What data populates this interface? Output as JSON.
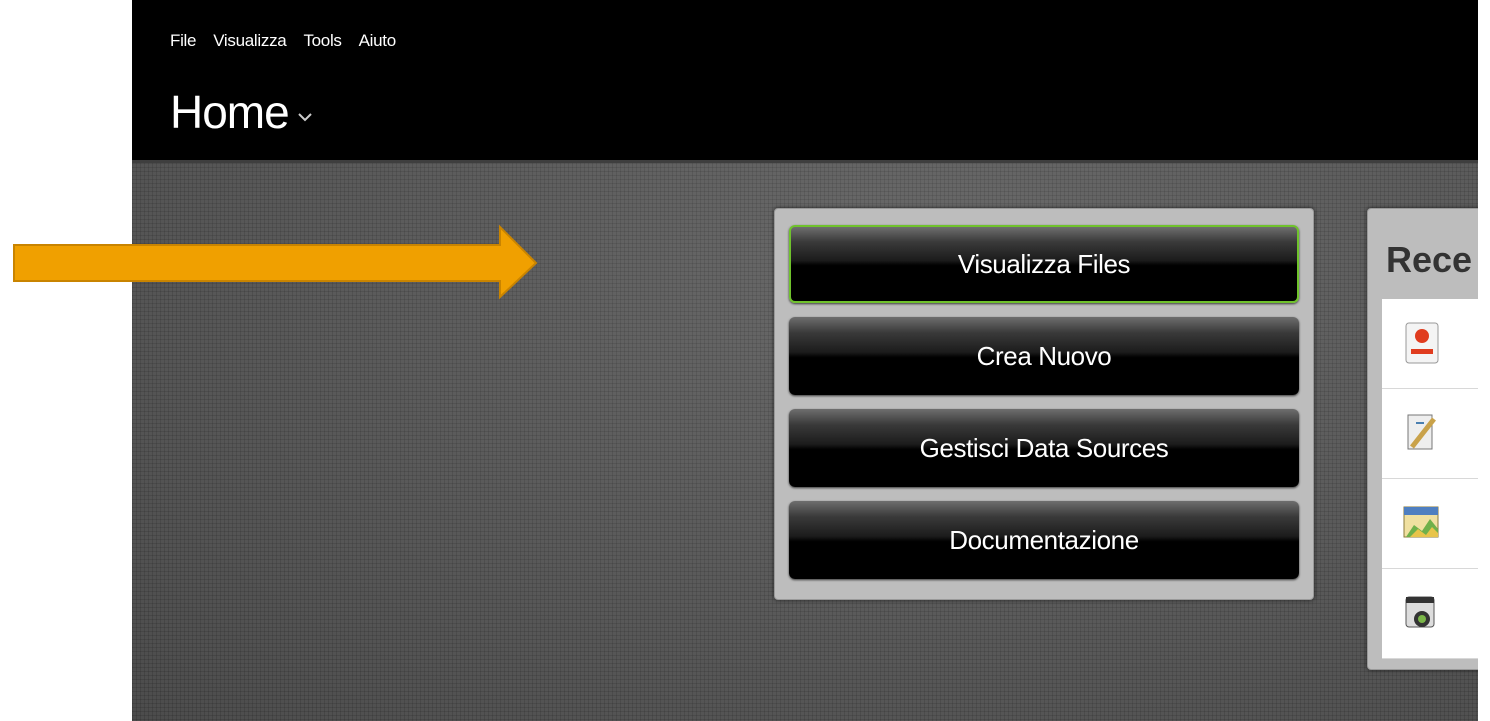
{
  "menubar": {
    "items": [
      "File",
      "Visualizza",
      "Tools",
      "Aiuto"
    ]
  },
  "header": {
    "title": "Home"
  },
  "actions": {
    "view_files": "Visualizza Files",
    "create_new": "Crea Nuovo",
    "manage_data_sources": "Gestisci Data Sources",
    "documentation": "Documentazione"
  },
  "recent": {
    "title": "Rece",
    "item_icons": [
      "presentation-file-icon",
      "report-file-icon",
      "analyzer-chart-icon",
      "dashboard-file-icon"
    ]
  },
  "colors": {
    "active_border": "#6fc22c",
    "annotation_arrow": "#f0a000",
    "topbar": "#000000"
  }
}
